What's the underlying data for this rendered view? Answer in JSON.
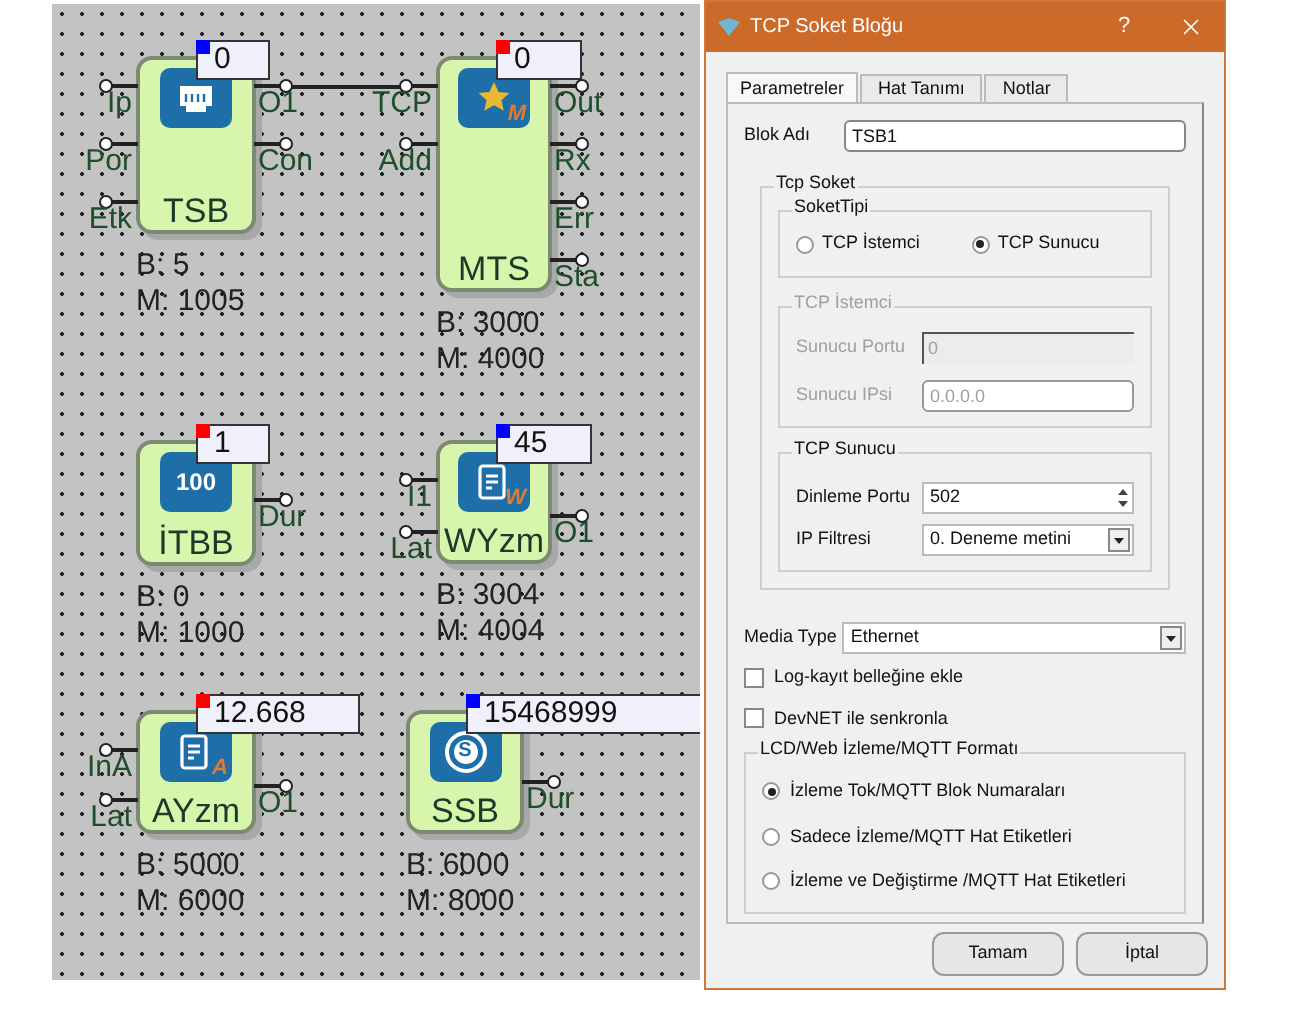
{
  "canvas": {
    "blocks": [
      {
        "name": "TSB",
        "value": "0",
        "color": "#0000ff",
        "inputs": [
          "Ip",
          "Por",
          "Etk"
        ],
        "outputs": [
          "O1",
          "Con"
        ],
        "b": "B: 5",
        "m": "M: 1005"
      },
      {
        "name": "MTS",
        "value": "0",
        "color": "#ff0000",
        "icon_text": "M",
        "inputs": [
          "TCP",
          "Add"
        ],
        "outputs": [
          "Out",
          "Rx",
          "Err",
          "Sta"
        ],
        "b": "B: 3000",
        "m": "M: 4000"
      },
      {
        "name": "İTBB",
        "value": "1",
        "color": "#ff0000",
        "icon_text": "100",
        "outputs": [
          "Dur"
        ],
        "b": "B: 0",
        "m": "M: 1000"
      },
      {
        "name": "WYzm",
        "value": "45",
        "color": "#0000ff",
        "icon_text": "W",
        "inputs": [
          "I1",
          "Lat"
        ],
        "outputs": [
          "O1"
        ],
        "b": "B: 3004",
        "m": "M: 4004"
      },
      {
        "name": "AYzm",
        "value": "12.668",
        "color": "#ff0000",
        "icon_text": "A",
        "inputs": [
          "InA",
          "Lat"
        ],
        "outputs": [
          "O1"
        ],
        "b": "B: 5000",
        "m": "M: 6000"
      },
      {
        "name": "SSB",
        "value": "15468999",
        "color": "#0000ff",
        "icon_text": "S",
        "outputs": [
          "Dur"
        ],
        "b": "B: 6000",
        "m": "M: 8000"
      }
    ]
  },
  "dialog": {
    "title": "TCP Soket Bloğu",
    "help": "?",
    "tabs": [
      {
        "label": "Parametreler",
        "selected": true
      },
      {
        "label": "Hat Tanımı",
        "selected": false
      },
      {
        "label": "Notlar",
        "selected": false
      }
    ],
    "block_name": {
      "label": "Blok Adı",
      "value": "TSB1"
    },
    "tcp_socket": {
      "title": "Tcp Soket",
      "socket_type": {
        "title": "SoketTipi",
        "options": [
          {
            "label": "TCP İstemci",
            "selected": false
          },
          {
            "label": "TCP Sunucu",
            "selected": true
          }
        ]
      },
      "tcp_client": {
        "title": "TCP İstemci",
        "disabled": true,
        "fields": [
          {
            "kind": "flat",
            "label": "Sunucu Portu",
            "value": "0"
          },
          {
            "kind": "text",
            "label": "Sunucu IPsi",
            "value": "0.0.0.0"
          }
        ]
      },
      "tcp_server": {
        "title": "TCP Sunucu",
        "fields": [
          {
            "kind": "spin",
            "label": "Dinleme Portu",
            "value": "502"
          },
          {
            "kind": "select",
            "label": "IP Filtresi",
            "value": "0. Deneme metini"
          }
        ]
      }
    },
    "media_type": {
      "label": "Media Type",
      "value": "Ethernet"
    },
    "checkboxes": [
      {
        "label": "Log-kayıt belleğine ekle",
        "checked": false
      },
      {
        "label": "DevNET ile senkronla",
        "checked": false
      }
    ],
    "format": {
      "title": "LCD/Web İzleme/MQTT Formatı",
      "options": [
        {
          "label": "İzleme Tok/MQTT Blok Numaraları",
          "selected": true
        },
        {
          "label": "Sadece İzleme/MQTT Hat Etiketleri",
          "selected": false
        },
        {
          "label": "İzleme ve Değiştirme /MQTT Hat Etiketleri",
          "selected": false
        }
      ]
    },
    "buttons": [
      "Tamam",
      "İptal"
    ]
  }
}
